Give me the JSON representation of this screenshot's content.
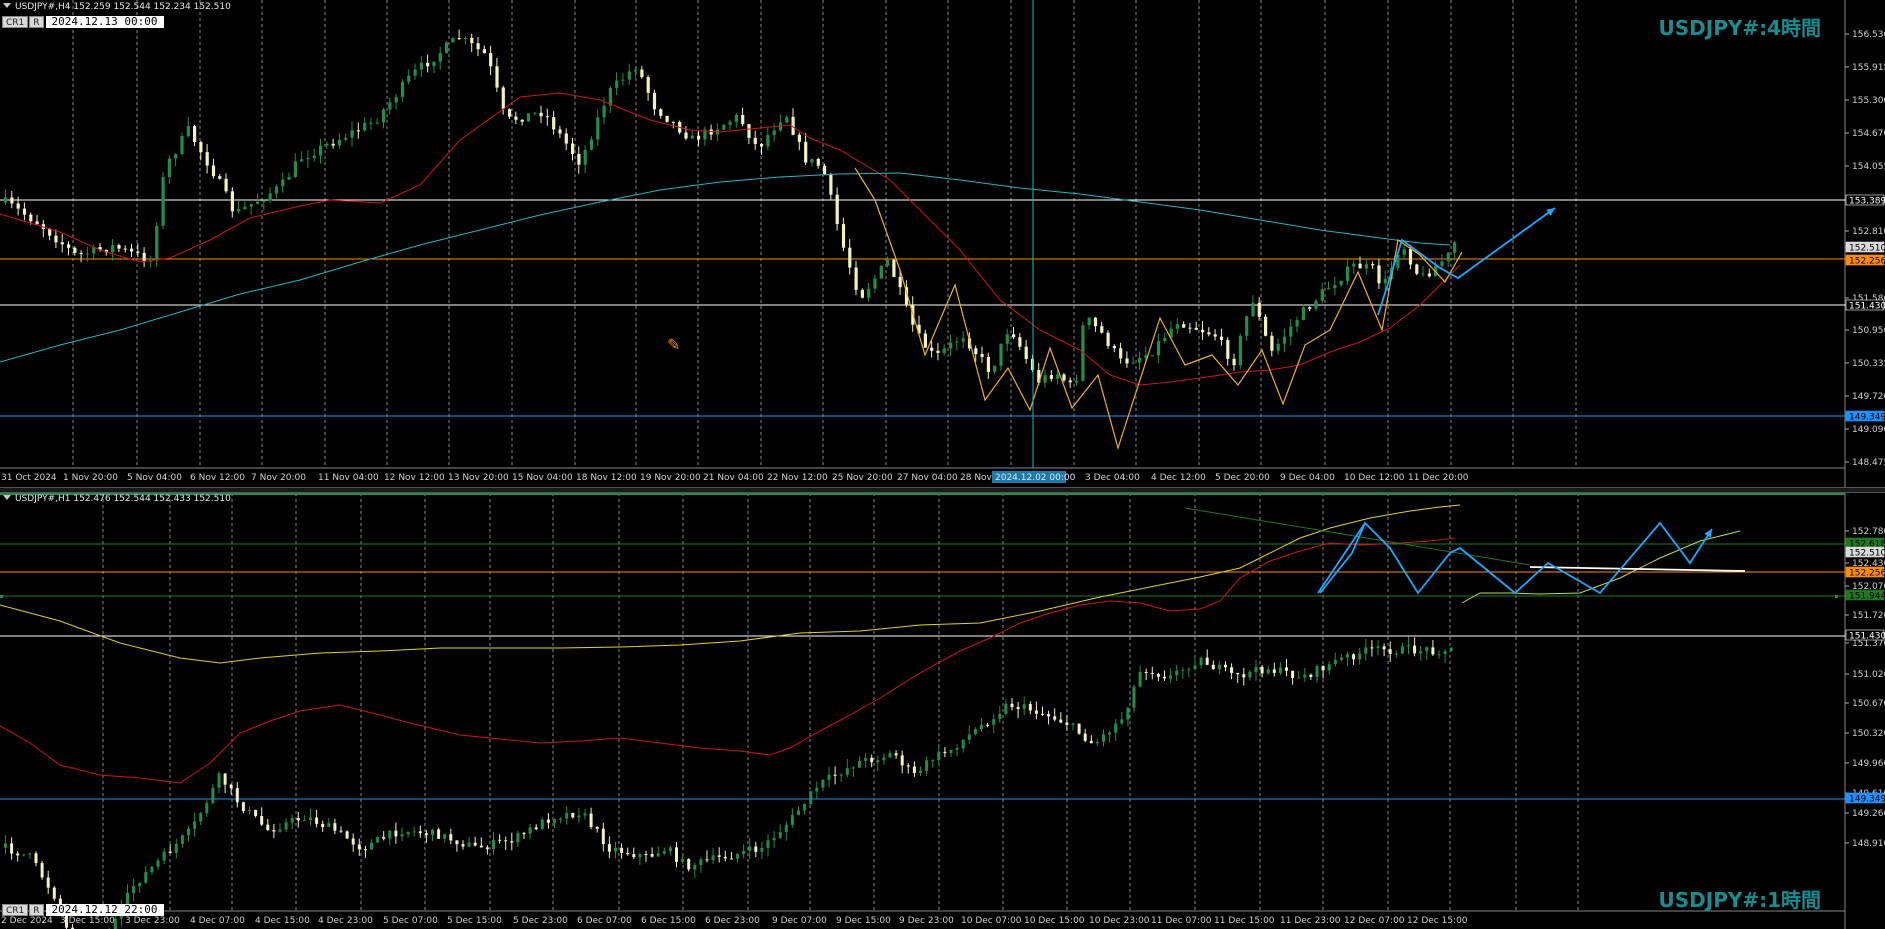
{
  "top_panel": {
    "header": "USDJPY#,H4  152.259 152.544 152.234 152.510",
    "badge_1": "CR1",
    "badge_2": "R",
    "crosshair_time": "2024.12.13 00:00",
    "title": "USDJPY#:4時間",
    "price_labels": [
      "156.530",
      "155.915",
      "155.300",
      "154.670",
      "154.055",
      "153.389",
      "152.810",
      "152.510",
      "152.256",
      "151.580",
      "151.430",
      "150.950",
      "150.335",
      "149.720",
      "149.349",
      "149.090",
      "148.475"
    ],
    "special_labels": [
      {
        "text": "153.389",
        "bg": "#000000",
        "fg": "#ffffff"
      },
      {
        "text": "152.510",
        "bg": "#d9d9d9",
        "fg": "#000000"
      },
      {
        "text": "152.256",
        "bg": "#ff8c00",
        "fg": "#000000"
      },
      {
        "text": "151.430",
        "bg": "#000000",
        "fg": "#ffffff"
      },
      {
        "text": "149.349",
        "bg": "#1e90ff",
        "fg": "#000000"
      }
    ],
    "time_labels": [
      "31 Oct 2024",
      "1 Nov 20:00",
      "5 Nov 04:00",
      "6 Nov 12:00",
      "7 Nov 20:00",
      "11 Nov 04:00",
      "12 Nov 12:00",
      "13 Nov 20:00",
      "15 Nov 04:00",
      "18 Nov 12:00",
      "19 Nov 20:00",
      "21 Nov 04:00",
      "22 Nov 12:00",
      "25 Nov 20:00",
      "27 Nov 04:00",
      "28 Nov",
      "2 Dec 00",
      "3 Dec 04:00",
      "4 Dec 12:00",
      "5 Dec 20:00",
      "9 Dec 04:00",
      "10 Dec 12:00",
      "11 Dec 20:00"
    ],
    "crosshair_axis_label": "2024.12.02 00:00"
  },
  "bottom_panel": {
    "header": "USDJPY#,H1  152.476 152.544 152.433 152.510",
    "badge_1": "CR1",
    "badge_2": "R",
    "crosshair_time": "2024.12.12 22:00",
    "title": "USDJPY#:1時間",
    "price_labels": [
      "152.780",
      "152.618",
      "152.510",
      "152.430",
      "152.256",
      "152.070",
      "151.944",
      "151.720",
      "151.430",
      "151.370",
      "151.020",
      "150.670",
      "150.320",
      "149.960",
      "149.610",
      "149.349",
      "149.260",
      "148.910"
    ],
    "special_labels": [
      {
        "text": "152.618",
        "bg": "#1f7a1f",
        "fg": "#000000"
      },
      {
        "text": "152.510",
        "bg": "#d9d9d9",
        "fg": "#000000"
      },
      {
        "text": "152.256",
        "bg": "#ff8c00",
        "fg": "#000000"
      },
      {
        "text": "151.944",
        "bg": "#1f7a1f",
        "fg": "#000000"
      },
      {
        "text": "151.430",
        "bg": "#000000",
        "fg": "#ffffff"
      },
      {
        "text": "149.349",
        "bg": "#1e90ff",
        "fg": "#000000"
      }
    ],
    "time_labels": [
      "2 Dec 2024",
      "3 Dec 15:00",
      "3 Dec 23:00",
      "4 Dec 07:00",
      "4 Dec 15:00",
      "4 Dec 23:00",
      "5 Dec 07:00",
      "5 Dec 15:00",
      "5 Dec 23:00",
      "6 Dec 07:00",
      "6 Dec 15:00",
      "6 Dec 23:00",
      "9 Dec 07:00",
      "9 Dec 15:00",
      "9 Dec 23:00",
      "10 Dec 07:00",
      "10 Dec 15:00",
      "10 Dec 23:00",
      "11 Dec 07:00",
      "11 Dec 15:00",
      "11 Dec 23:00",
      "12 Dec 07:00",
      "12 Dec 15:00"
    ]
  },
  "colors": {
    "bull": "#1f8f4a",
    "bear": "#f2f2c0",
    "ma_fast": "#d21414",
    "ma_slow_h4": "#1fb5c8",
    "ma_slow_h1": "#e0d21a",
    "zigzag": "#f0b020",
    "projection": "#1aa8ff",
    "accent_title": "#168d90"
  }
}
